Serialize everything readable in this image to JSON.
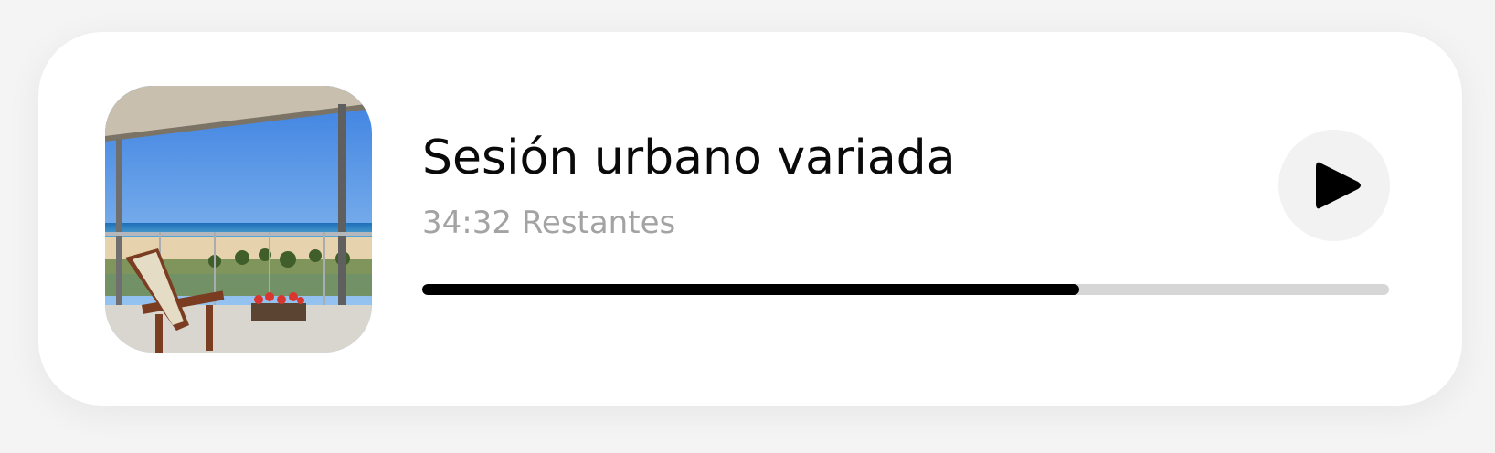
{
  "player": {
    "title": "Sesión urbano variada",
    "remaining": "34:32 Restantes",
    "progress_fraction": 0.68,
    "cover_icon": "balcony-beach-photo",
    "play_icon": "play-icon"
  },
  "colors": {
    "progress_fill": "#000000",
    "progress_track": "#d6d6d6",
    "play_bg": "#f2f2f2",
    "subtitle": "#a3a3a3"
  }
}
